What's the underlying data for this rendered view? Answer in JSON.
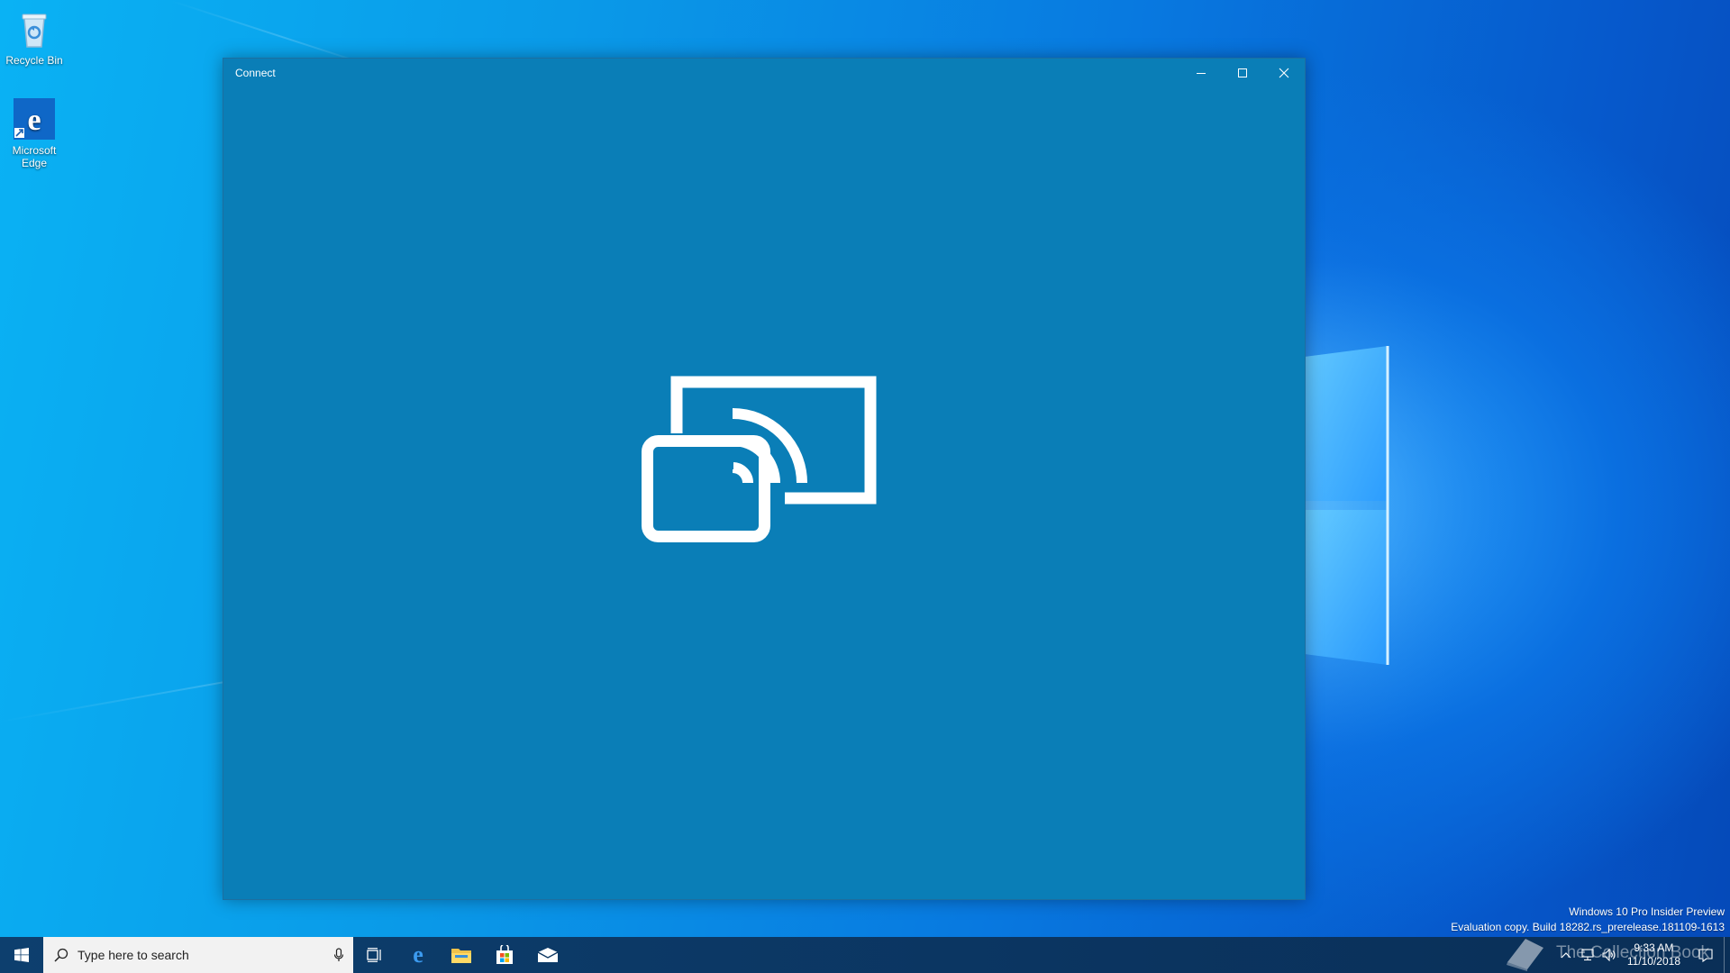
{
  "desktop": {
    "icons": [
      {
        "label": "Recycle Bin",
        "icon": "recycle-bin-icon"
      },
      {
        "label": "Microsoft Edge",
        "icon": "edge-icon"
      }
    ]
  },
  "window": {
    "title": "Connect",
    "background": "#0a7eb7",
    "center_icon": "project-connect-icon"
  },
  "taskbar": {
    "search_placeholder": "Type here to search",
    "pinned": [
      "task-view-icon",
      "edge-icon",
      "file-explorer-icon",
      "store-icon",
      "mail-icon"
    ],
    "clock_time": "9:33 AM",
    "clock_date": "11/10/2018"
  },
  "watermark": {
    "line1": "Windows 10 Pro Insider Preview",
    "line2": "Evaluation copy. Build 18282.rs_prerelease.181109-1613"
  },
  "credit": "The Collection Book",
  "colors": {
    "accent": "#0078d7",
    "taskbar": "#0b3561",
    "search_bg": "#f2f2f2"
  }
}
